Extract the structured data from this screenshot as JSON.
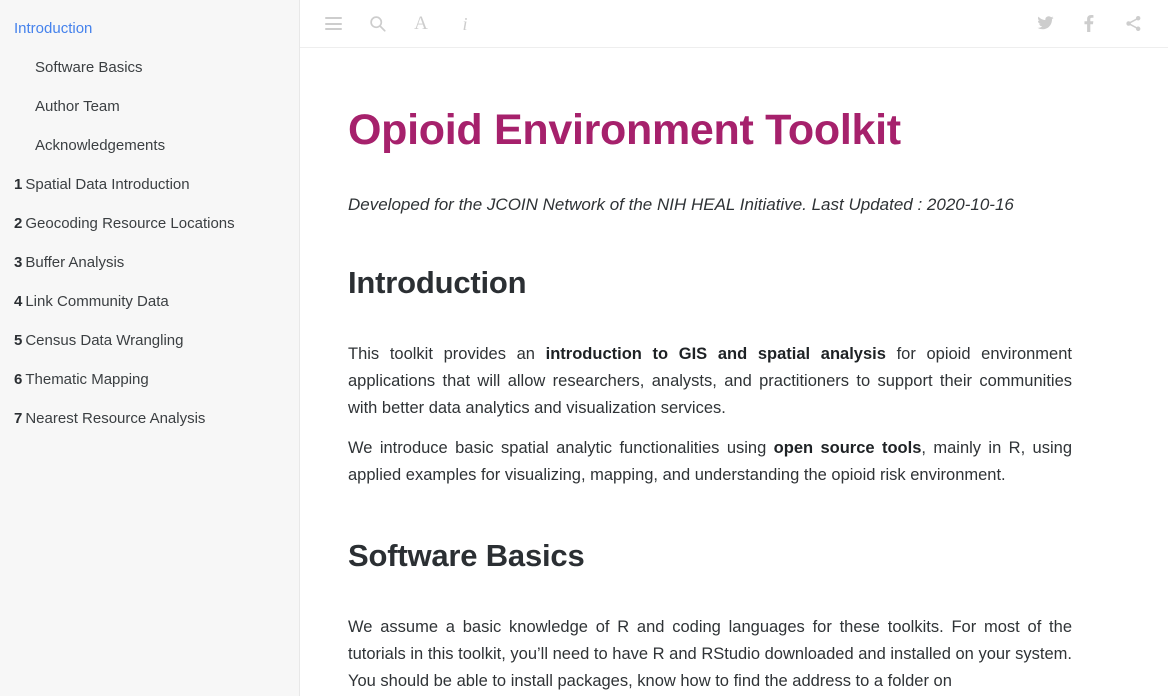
{
  "sidebar": {
    "items": [
      {
        "num": "",
        "label": "Introduction",
        "active": true,
        "sub": false
      },
      {
        "num": "",
        "label": "Software Basics",
        "active": false,
        "sub": true
      },
      {
        "num": "",
        "label": "Author Team",
        "active": false,
        "sub": true
      },
      {
        "num": "",
        "label": "Acknowledgements",
        "active": false,
        "sub": true
      },
      {
        "num": "1",
        "label": "Spatial Data Introduction",
        "active": false,
        "sub": false
      },
      {
        "num": "2",
        "label": "Geocoding Resource Locations",
        "active": false,
        "sub": false
      },
      {
        "num": "3",
        "label": "Buffer Analysis",
        "active": false,
        "sub": false
      },
      {
        "num": "4",
        "label": "Link Community Data",
        "active": false,
        "sub": false
      },
      {
        "num": "5",
        "label": "Census Data Wrangling",
        "active": false,
        "sub": false
      },
      {
        "num": "6",
        "label": "Thematic Mapping",
        "active": false,
        "sub": false
      },
      {
        "num": "7",
        "label": "Nearest Resource Analysis",
        "active": false,
        "sub": false
      }
    ]
  },
  "toolbar": {
    "left_icons": [
      "menu-icon",
      "search-icon",
      "font-size-icon",
      "info-icon"
    ],
    "right_icons": [
      "twitter-icon",
      "facebook-icon",
      "share-icon"
    ],
    "font_glyph": "A",
    "info_glyph": "i"
  },
  "content": {
    "title": "Opioid Environment Toolkit",
    "subtitle": "Developed for the JCOIN Network of the NIH HEAL Initiative. Last Updated : 2020-10-16",
    "intro_heading": "Introduction",
    "intro_p1_a": "This toolkit provides an ",
    "intro_p1_b": "introduction to GIS and spatial analysis",
    "intro_p1_c": " for opioid environment applications that will allow researchers, analysts, and practitioners to support their communities with better data analytics and visualization services.",
    "intro_p2_a": "We introduce basic spatial analytic functionalities using ",
    "intro_p2_b": "open source tools",
    "intro_p2_c": ", mainly in R, using applied examples for visualizing, mapping, and understanding the opioid risk environment.",
    "software_heading": "Software Basics",
    "software_p1": "We assume a basic knowledge of R and coding languages for these toolkits. For most of the tutorials in this toolkit, you’ll need to have R and RStudio downloaded and installed on your system. You should be able to install packages, know how to find the address to a folder on"
  },
  "colors": {
    "title_magenta": "#a6216c",
    "active_link_blue": "#4582ec",
    "sidebar_bg": "#f7f7f7",
    "icon_gray": "#cdcdcd"
  }
}
